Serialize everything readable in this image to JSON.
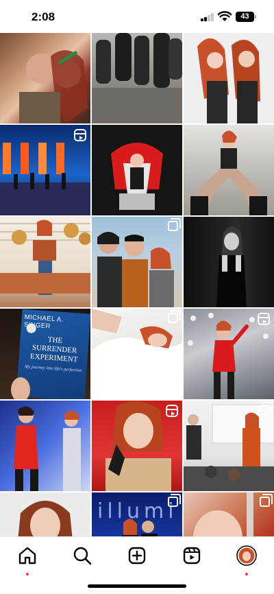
{
  "status_bar": {
    "time": "2:08",
    "battery": "43"
  },
  "grid": {
    "tiles": [
      {
        "name": "post-couple-christmas",
        "overlay": "none"
      },
      {
        "name": "post-group-street",
        "overlay": "none"
      },
      {
        "name": "post-two-redheads",
        "overlay": "none"
      },
      {
        "name": "post-stage-performance",
        "overlay": "reels-icon"
      },
      {
        "name": "post-voice-red-chair",
        "overlay": "none"
      },
      {
        "name": "post-fishnet-pose",
        "overlay": "none"
      },
      {
        "name": "post-sunny-lounge",
        "overlay": "none"
      },
      {
        "name": "post-beach-friends",
        "overlay": "carousel-icon"
      },
      {
        "name": "post-black-white-portrait",
        "overlay": "none"
      },
      {
        "name": "post-surrender-experiment-book",
        "overlay": "none"
      },
      {
        "name": "post-sleeping-in-bed",
        "overlay": "carousel-icon"
      },
      {
        "name": "post-red-bodysuit-stage",
        "overlay": "reels-icon"
      },
      {
        "name": "post-duet-on-stage",
        "overlay": "none"
      },
      {
        "name": "post-selfie-red-carpet",
        "overlay": "reels-icon"
      },
      {
        "name": "post-classroom-talk",
        "overlay": "carousel-icon"
      },
      {
        "name": "post-studio-portrait",
        "overlay": "none"
      },
      {
        "name": "post-illumi-event",
        "overlay": "carousel-icon"
      },
      {
        "name": "post-laughing-closeup",
        "overlay": "carousel-icon"
      }
    ],
    "book": {
      "author": "MICHAEL A. SINGER",
      "title_line1": "THE",
      "title_line2": "SURRENDER",
      "title_line3": "EXPERIMENT",
      "subtitle": "My journey into life's perfection"
    },
    "illumi_text": "illumi"
  },
  "bottom_nav": {
    "items": [
      {
        "name": "home",
        "icon": "home-icon"
      },
      {
        "name": "search",
        "icon": "search-icon"
      },
      {
        "name": "create",
        "icon": "plus-square-icon"
      },
      {
        "name": "reels",
        "icon": "reels-icon"
      },
      {
        "name": "profile",
        "icon": "avatar"
      }
    ]
  },
  "colors": {
    "notification_dot": "#ff3040",
    "accent_red_hair": "#c8502a"
  }
}
